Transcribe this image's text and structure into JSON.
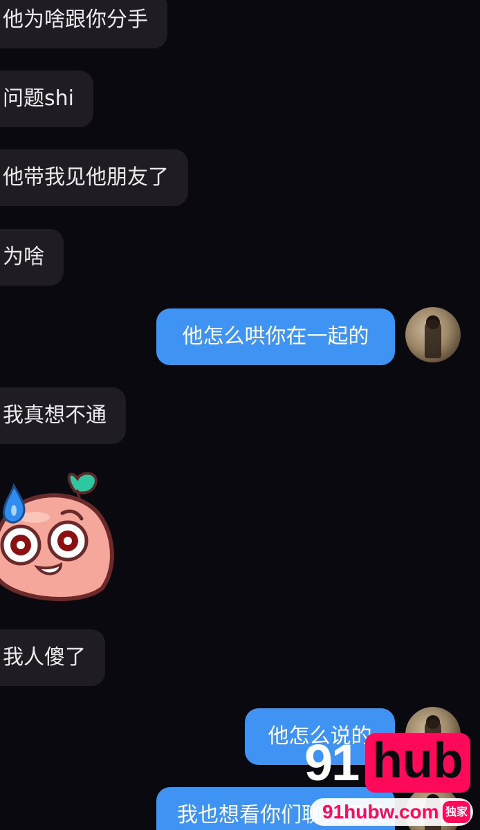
{
  "conversation": {
    "messages": [
      {
        "side": "left",
        "text": "他为啥跟你分手"
      },
      {
        "side": "left",
        "text": "问题shi"
      },
      {
        "side": "left",
        "text": "他带我见他朋友了"
      },
      {
        "side": "left",
        "text": "为啥"
      },
      {
        "side": "right",
        "text": "他怎么哄你在一起的"
      },
      {
        "side": "left",
        "text": "我真想不通"
      },
      {
        "side": "left",
        "type": "sticker",
        "sticker": "sweating-blob-emoji"
      },
      {
        "side": "left",
        "text": "我人傻了"
      },
      {
        "side": "right",
        "text": "他怎么说的"
      },
      {
        "side": "right",
        "text": "我也想看你们聊天记录"
      }
    ]
  },
  "watermark": {
    "brand_number": "91",
    "brand_word": "hub",
    "url": "91hubw.com",
    "badge": "独家",
    "accent_color": "#ff0a5a"
  },
  "colors": {
    "background": "#0b0910",
    "incoming_bubble": "#1f1d23",
    "outgoing_bubble": "#3f94f3"
  }
}
